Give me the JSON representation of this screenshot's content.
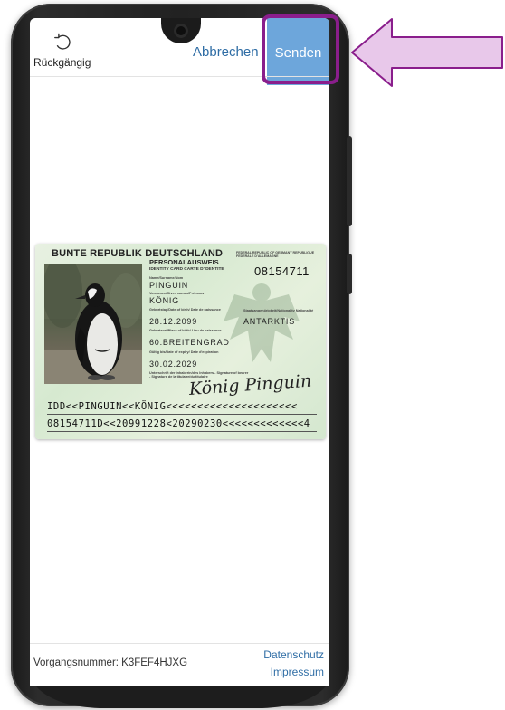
{
  "toolbar": {
    "undo_label": "Rückgängig",
    "undo_icon": "undo-icon",
    "cancel_label": "Abbrechen",
    "send_label": "Senden",
    "send_color": "#6da6db",
    "link_color": "#2f6da5"
  },
  "id_card": {
    "country_title": "BUNTE REPUBLIK DEUTSCHLAND",
    "country_en_fr": "FEDERAL REPUBLIC OF GERMANY REPUBLIQUE FEDERALE D'ALLEMAGNE",
    "doc_title": "PERSONALAUSWEIS",
    "doc_subtitle": "IDENTITY CARD CARTE D'IDENTITE",
    "card_number": "08154711",
    "fields": [
      {
        "label": "Name/Surname/Nom",
        "value": "PINGUIN"
      },
      {
        "label": "Vornamen/Given names/Prénoms",
        "value": "KÖNIG"
      },
      {
        "label": "Geburtstag/Date of birth/ Date de naissance",
        "value": "28.12.2099"
      },
      {
        "label": "Geburtsort/Place of birth/ Lieu de naissance",
        "value": "60.BREITENGRAD"
      },
      {
        "label": "Gültig bis/Date of expiry/ Date d'expiration",
        "value": "30.02.2029"
      }
    ],
    "nationality_label": "Staatsangehörigkeit/Nationality Nationalité",
    "nationality_value": "ANTARKTIS",
    "signature_label": "Unterschrift der Inhaberin/des Inhabers - Signature of bearer - Signature de la titulaire/du titulaire",
    "signature": "König Pinguin",
    "mrz_line1": "IDD<<PINGUIN<<KÖNIG<<<<<<<<<<<<<<<<<<<<<",
    "mrz_line2": "08154711D<<20991228<20290230<<<<<<<<<<<<<4"
  },
  "footer": {
    "case_number_text": "Vorgangsnummer: K3FEF4HJXG",
    "privacy_link": "Datenschutz",
    "imprint_link": "Impressum"
  },
  "annotation": {
    "highlight_color": "#8a1e8c",
    "arrow_fill": "#e8c8ea",
    "arrow_stroke": "#8a1e8c"
  }
}
